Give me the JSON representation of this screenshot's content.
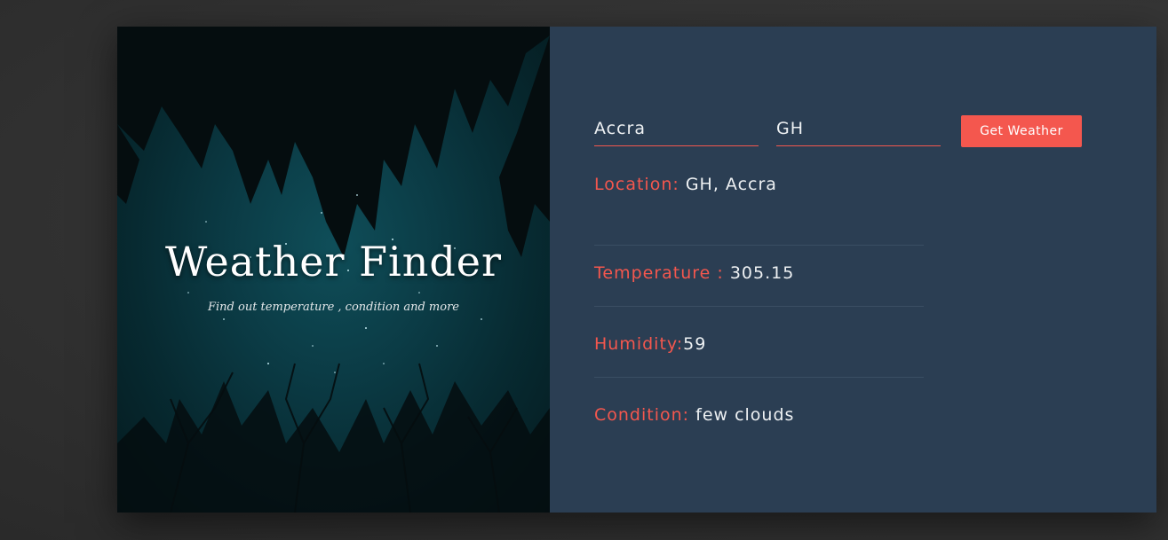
{
  "hero": {
    "title": "Weather Finder",
    "subtitle": "Find out temperature , condition and more"
  },
  "form": {
    "city_value": "Accra",
    "country_value": "GH",
    "submit_label": "Get Weather"
  },
  "results": {
    "location_label": "Location:",
    "location_value": "GH, Accra",
    "temperature_label": "Temperature :",
    "temperature_value": "305.15",
    "humidity_label": "Humidity:",
    "humidity_value": "59",
    "condition_label": "Condition:",
    "condition_value": "few clouds"
  },
  "colors": {
    "accent": "#f4574e",
    "panel": "#2b3e53",
    "text": "#eef1f3"
  }
}
